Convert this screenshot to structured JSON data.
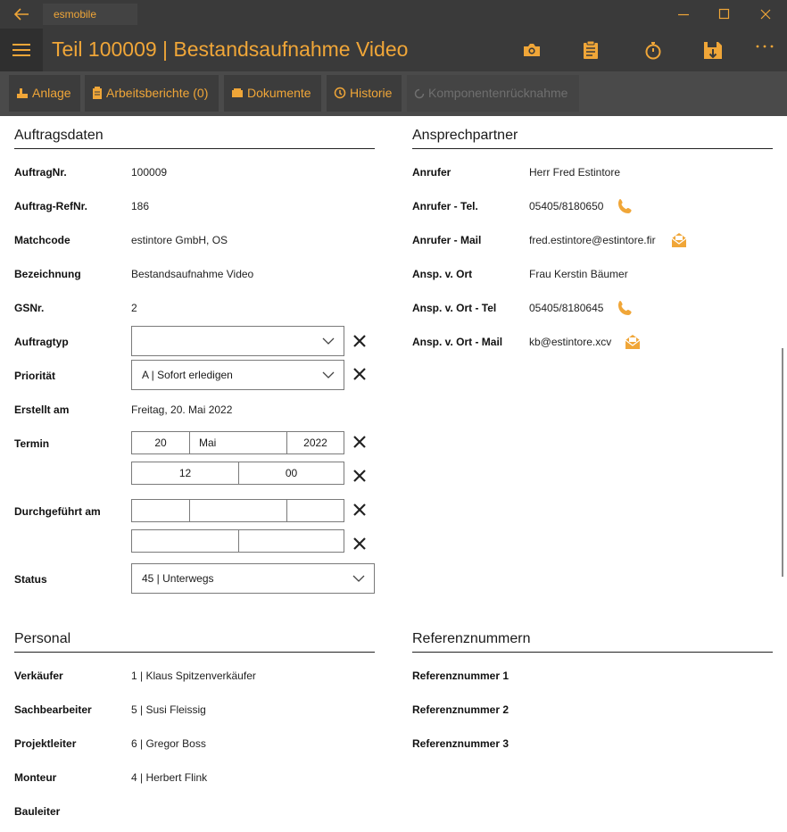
{
  "titlebar": {
    "app_name": "esmobile"
  },
  "header": {
    "title": "Teil 100009  |  Bestandsaufnahme Video"
  },
  "toolbar": {
    "anlage": "Anlage",
    "arbeitsberichte": "Arbeitsberichte (0)",
    "dokumente": "Dokumente",
    "historie": "Historie",
    "komponenten": "Komponentenrücknahme"
  },
  "auftragsdaten": {
    "heading": "Auftragsdaten",
    "auftragnr_label": "AuftragNr.",
    "auftragnr": "100009",
    "refnr_label": "Auftrag-RefNr.",
    "refnr": "186",
    "matchcode_label": "Matchcode",
    "matchcode": "estintore GmbH, OS",
    "bezeichnung_label": "Bezeichnung",
    "bezeichnung": "Bestandsaufnahme Video",
    "gsnr_label": "GSNr.",
    "gsnr": "2",
    "auftragtyp_label": "Auftragtyp",
    "auftragtyp": "",
    "prioritaet_label": "Priorität",
    "prioritaet": "A  |  Sofort erledigen",
    "erstellt_label": "Erstellt am",
    "erstellt": "Freitag, 20. Mai 2022",
    "termin_label": "Termin",
    "termin_day": "20",
    "termin_month": "Mai",
    "termin_year": "2022",
    "termin_hour": "12",
    "termin_minute": "00",
    "durchgefuehrt_label": "Durchgeführt am",
    "status_label": "Status",
    "status": "45  |  Unterwegs"
  },
  "ansprechpartner": {
    "heading": "Ansprechpartner",
    "anrufer_label": "Anrufer",
    "anrufer": "Herr Fred Estintore",
    "anrufer_tel_label": "Anrufer - Tel.",
    "anrufer_tel": "05405/8180650",
    "anrufer_mail_label": "Anrufer - Mail",
    "anrufer_mail": "fred.estintore@estintore.fir",
    "ansp_label": "Ansp. v. Ort",
    "ansp": "Frau Kerstin Bäumer",
    "ansp_tel_label": "Ansp. v. Ort - Tel",
    "ansp_tel": "05405/8180645",
    "ansp_mail_label": "Ansp. v. Ort - Mail",
    "ansp_mail": "kb@estintore.xcv"
  },
  "personal": {
    "heading": "Personal",
    "verkaeufer_label": "Verkäufer",
    "verkaeufer": "1  |  Klaus Spitzenverkäufer",
    "sachbearbeiter_label": "Sachbearbeiter",
    "sachbearbeiter": "5  |  Susi Fleissig",
    "projektleiter_label": "Projektleiter",
    "projektleiter": "6  |  Gregor Boss",
    "monteur_label": "Monteur",
    "monteur": "4  |  Herbert Flink",
    "bauleiter_label": "Bauleiter"
  },
  "referenz": {
    "heading": "Referenznummern",
    "ref1_label": "Referenznummer 1",
    "ref2_label": "Referenznummer 2",
    "ref3_label": "Referenznummer 3"
  },
  "colors": {
    "accent": "#f0a638",
    "dark": "#3a3a3a",
    "toolbar": "#4a4a4a"
  },
  "icons": [
    "back-arrow-icon",
    "minimize-icon",
    "maximize-icon",
    "close-icon",
    "hamburger-icon",
    "camera-icon",
    "clipboard-icon",
    "stopwatch-icon",
    "save-icon",
    "more-icon",
    "phone-icon",
    "mail-icon"
  ]
}
